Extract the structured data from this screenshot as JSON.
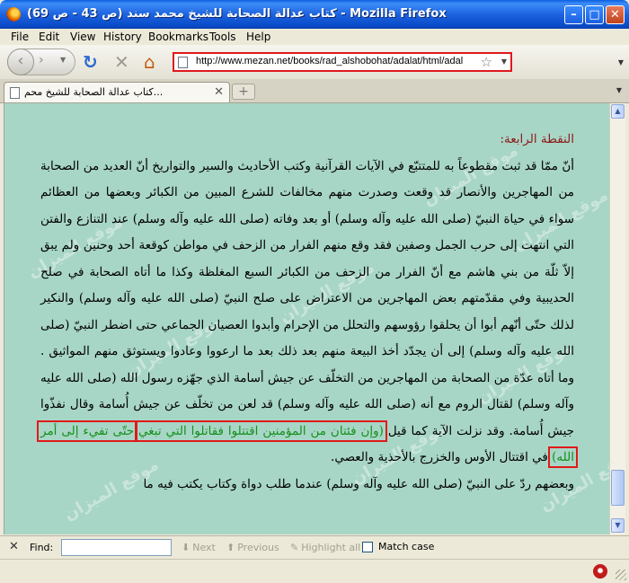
{
  "window": {
    "title": "(كتاب عدالة الصحابة للشيخ محمد سند (ص 43 - ص 69 - Mozilla Firefox",
    "minimize": "–",
    "maximize": "□",
    "close": "✕"
  },
  "menu": {
    "file": "File",
    "edit": "Edit",
    "view": "View",
    "history": "History",
    "bookmarks": "Bookmarks",
    "tools": "Tools",
    "help": "Help"
  },
  "nav": {
    "url": "http://www.mezan.net/books/rad_alshobohat/adalat/html/adal",
    "back_glyph": "‹",
    "fwd_glyph": "›",
    "reload_glyph": "↻",
    "stop_glyph": "✕",
    "home_glyph": "⌂",
    "star_glyph": "☆"
  },
  "tab": {
    "title": "كتاب عدالة الصحابة للشيخ محم...",
    "new_tab": "+"
  },
  "content": {
    "watermark": "موقع الميزان",
    "heading": "النقطة الرابعة:",
    "para1": "أنّ ممّا قد ثبت مقطوعاً به للمتتبّع في الآيات القرآنية وكتب الأحاديث والسير والتواريخ أنّ العديد من الصحابة من المهاجرين والأنصار قد وقعت وصدرت منهم مخالفات للشرع المبين من الكبائر وبعضها من العظائم سواء في حياة النبيّ (صلى الله عليه وآله وسلم) أو بعد وفاته (صلى الله عليه وآله وسلم) عند التنازع والفتن التي انتهت إلى حرب الجمل وصفين فقد وقع منهم الفرار من الزحف في مواطن كوقعة أحد وحنين ولم يبق إلاّ ثلّة من بني هاشم مع أنّ الفرار من الزحف من الكبائر السبع المغلظة وكذا ما أتاه الصحابة في صلح الحديبية وفي مقدّمتهم بعض المهاجرين من الاعتراض على صلح النبيّ (صلى الله عليه وآله وسلم) والنكير لذلك حتّى أنّهم أبوا أن يحلقوا رؤوسهم والتحلل من الإحرام وأبدوا العصيان الجماعي حتى اضطر النبيّ (صلى الله عليه وآله وسلم) إلى أن يجدّد أخذ البيعة منهم بعد ذلك بعد ما ارعووا وعادوا ويستوثق منهم المواثيق . وما أتاه عدّة من الصحابة من المهاجرين من التخلّف عن جيش أسامة الذي جهّزه رسول الله (صلى الله عليه وآله وسلم) لقتال الروم مع أنه (صلى الله عليه وآله وسلم) قد لعن من تخلّف عن جيش أُسامة وقال نفذّوا جيش أُسامة. وقد نزلت الآية كما قيل",
    "quran1": "(وإن فئتان من المؤمنين اقتتلوا فقاتلوا التي تبغي",
    "quran2": "حتّى تفيء إلى أمر الله)",
    "para1_end": "في اقتتال الأوس والخزرج بالأحذية والعصي.",
    "para2": "وبعضهم ردّ على النبيّ (صلى الله عليه وآله وسلم) عندما طلب دواة وكتاب يكتب فيه ما"
  },
  "findbar": {
    "close": "✕",
    "label": "Find:",
    "value": "",
    "next": "Next",
    "previous": "Previous",
    "highlight": "Highlight all",
    "match_case": "Match case"
  }
}
